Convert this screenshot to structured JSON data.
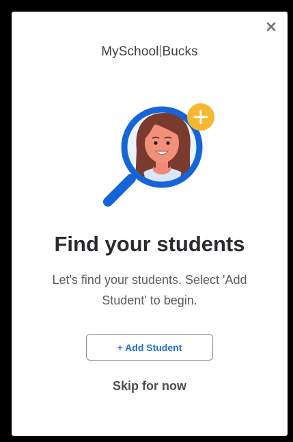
{
  "modal": {
    "brand": {
      "part1": "MySchool",
      "part2": "Bucks"
    },
    "title": "Find your students",
    "description": "Let's find your students. Select 'Add Student' to begin.",
    "add_button_label": "+ Add Student",
    "skip_label": "Skip for now",
    "icons": {
      "close": "close-icon",
      "hero": "magnifier-student-illustration",
      "plus_badge": "plus-badge-icon"
    }
  },
  "colors": {
    "accent_blue": "#1f6fd6",
    "badge_yellow": "#f7b731",
    "frame": "#000000"
  }
}
